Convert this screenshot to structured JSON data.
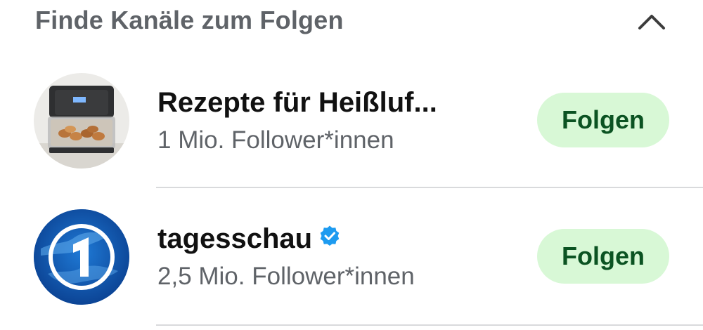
{
  "section": {
    "title": "Finde Kanäle zum Folgen",
    "collapse_icon": "chevron-up-icon"
  },
  "channels": [
    {
      "name": "Rezepte für Heißluf...",
      "followers": "1 Mio. Follower*innen",
      "follow_label": "Folgen",
      "verified": false,
      "avatar": "air-fryer-photo"
    },
    {
      "name": "tagesschau",
      "followers": "2,5 Mio. Follower*innen",
      "follow_label": "Folgen",
      "verified": true,
      "verified_icon": "verified-badge-icon",
      "avatar": "tagesschau-logo"
    }
  ],
  "colors": {
    "follow_bg": "#d8f8d6",
    "follow_text": "#0b5322",
    "verified": "#1d9bf0",
    "secondary_text": "#5f6368"
  }
}
